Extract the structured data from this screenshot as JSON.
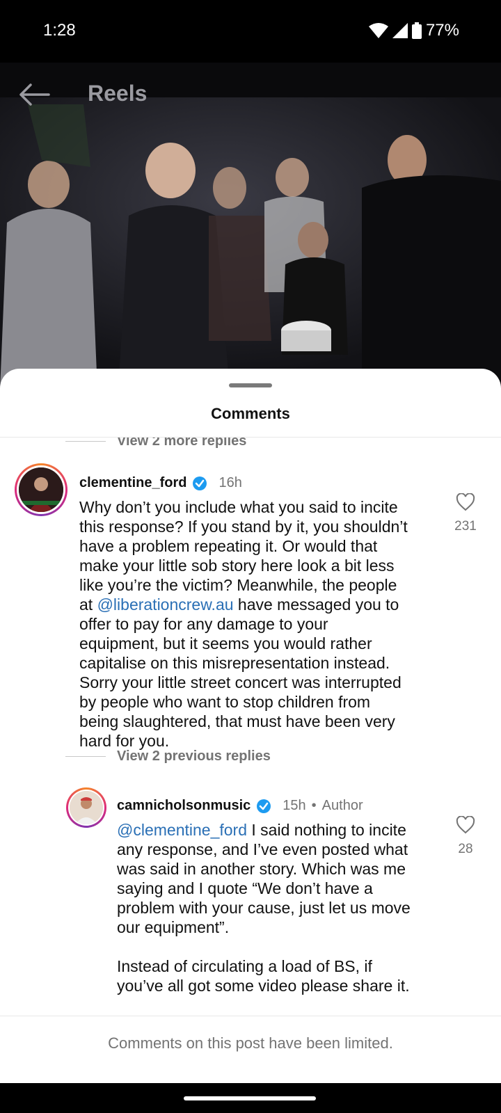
{
  "status_bar": {
    "time": "1:28",
    "battery": "77%"
  },
  "header": {
    "title": "Reels"
  },
  "sheet": {
    "title": "Comments"
  },
  "thread": {
    "view_more_replies": "View 2 more replies",
    "comment1": {
      "username": "clementine_ford",
      "time": "16h",
      "likes": "231",
      "lines": [
        "Why don’t you include what you said to incite",
        "this response? If you stand by it, you shouldn’t",
        "have a problem repeating it. Or would that",
        "make your little sob story here look a bit less",
        "like you’re the victim? Meanwhile, the people"
      ],
      "line6_prefix": "at ",
      "line6_mention": "@liberationcrew.au",
      "line6_suffix": " have messaged you to",
      "lines_after": [
        "offer to pay for any damage to your",
        "equipment, but it seems you would rather",
        "capitalise on this misrepresentation instead.",
        "Sorry your little street concert was interrupted",
        "by people who want to stop children from",
        "being slaughtered, that must have been very",
        "hard for you."
      ]
    },
    "view_previous_replies": "View 2 previous replies",
    "reply1": {
      "username": "camnicholsonmusic",
      "time": "15h",
      "author_label": "Author",
      "likes": "28",
      "mention": "@clementine_ford",
      "line1_rest": " I said nothing to incite",
      "lines": [
        "any response, and I’ve even posted what",
        "was said in another story. Which was me",
        "saying and I quote “We don’t have a",
        "problem with your cause, just let us move",
        "our equipment”."
      ],
      "para2": [
        "Instead of circulating a load of BS, if",
        "you’ve all got some video please share it."
      ]
    }
  },
  "footer": {
    "limited_text": "Comments on this post have been limited."
  }
}
